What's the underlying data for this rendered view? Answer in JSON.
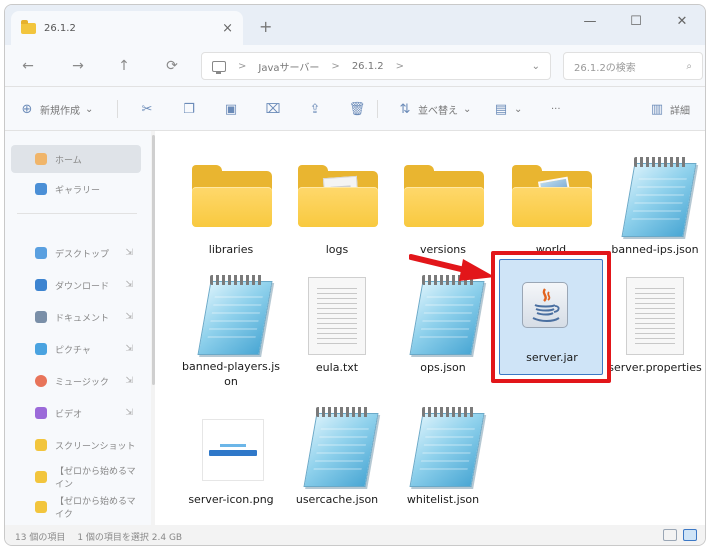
{
  "tab": {
    "title": "26.1.2",
    "close": "×",
    "new_tab": "+"
  },
  "window_controls": {
    "minimize": "—",
    "maximize": "☐",
    "close": "✕"
  },
  "nav": {
    "back": "←",
    "forward": "→",
    "up": "↑",
    "refresh": "⟳"
  },
  "address": {
    "crumbs": [
      "Javaサーバー",
      "26.1.2"
    ],
    "sep": ">",
    "more": ">",
    "dropdown": "⌄"
  },
  "search": {
    "placeholder": "26.1.2の検索",
    "icon": "⌕"
  },
  "commands": {
    "new_label": "新規作成",
    "sort_label": "並べ替え",
    "details_label": "詳細",
    "view_more": "⌄",
    "more": "···"
  },
  "sidebar": {
    "items": [
      {
        "label": "ホーム",
        "color": "#f0b56a",
        "pinned": false
      },
      {
        "label": "ギャラリー",
        "color": "#4b8fd6",
        "pinned": false
      },
      {
        "label": "デスクトップ",
        "color": "#5aa0e0",
        "pinned": true
      },
      {
        "label": "ダウンロード",
        "color": "#3d84d0",
        "pinned": true
      },
      {
        "label": "ドキュメント",
        "color": "#7a8fa8",
        "pinned": true
      },
      {
        "label": "ピクチャ",
        "color": "#4aa3e0",
        "pinned": true
      },
      {
        "label": "ミュージック",
        "color": "#e8745a",
        "pinned": true
      },
      {
        "label": "ビデオ",
        "color": "#9b6ad9",
        "pinned": true
      },
      {
        "label": "スクリーンショット",
        "color": "#f2c53d",
        "pinned": false
      },
      {
        "label": "【ゼロから始めるマイン",
        "color": "#f2c53d",
        "pinned": false
      },
      {
        "label": "【ゼロから始めるマイク",
        "color": "#f2c53d",
        "pinned": false
      }
    ],
    "pin_glyph": "⇲"
  },
  "files": [
    {
      "name": "libraries",
      "kind": "folder"
    },
    {
      "name": "logs",
      "kind": "folder-doc"
    },
    {
      "name": "versions",
      "kind": "folder"
    },
    {
      "name": "world",
      "kind": "folder-photo"
    },
    {
      "name": "banned-ips.json",
      "kind": "notepad"
    },
    {
      "name": "banned-players.json",
      "kind": "notepad"
    },
    {
      "name": "eula.txt",
      "kind": "text"
    },
    {
      "name": "ops.json",
      "kind": "notepad"
    },
    {
      "name": "server.jar",
      "kind": "jar"
    },
    {
      "name": "server.properties",
      "kind": "text"
    },
    {
      "name": "server-icon.png",
      "kind": "png"
    },
    {
      "name": "usercache.json",
      "kind": "notepad"
    },
    {
      "name": "whitelist.json",
      "kind": "notepad"
    }
  ],
  "png_thumb": {
    "line1": "ゼロから始める",
    "line2": "マイクラサーバー運営ラップ"
  },
  "status": {
    "count": "13 個の項目",
    "selected": "1 個の項目を選択 2.4 GB"
  },
  "colors": {
    "highlight": "#e2161a",
    "selection": "#cfe4f7",
    "folder": "#f8c93f"
  }
}
